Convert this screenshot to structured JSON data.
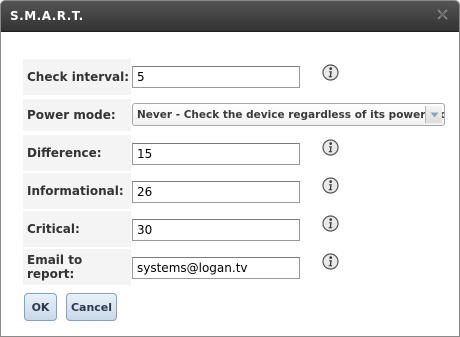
{
  "dialog": {
    "title": "S.M.A.R.T."
  },
  "form": {
    "check_interval": {
      "label": "Check interval:",
      "value": "5"
    },
    "power_mode": {
      "label": "Power mode:",
      "value": "Never - Check the device regardless of its power mode"
    },
    "difference": {
      "label": "Difference:",
      "value": "15"
    },
    "informational": {
      "label": "Informational:",
      "value": "26"
    },
    "critical": {
      "label": "Critical:",
      "value": "30"
    },
    "email": {
      "label": "Email to report:",
      "value": "systems@logan.tv"
    }
  },
  "buttons": {
    "ok": "OK",
    "cancel": "Cancel"
  },
  "icons": {
    "close": "close-icon",
    "info": "info-icon",
    "select_arrow": "chevron-down-icon"
  },
  "colors": {
    "titlebar": "#3d3d3d",
    "label_bg": "#f4f4f4",
    "button_bg": "#d6e3f0"
  }
}
